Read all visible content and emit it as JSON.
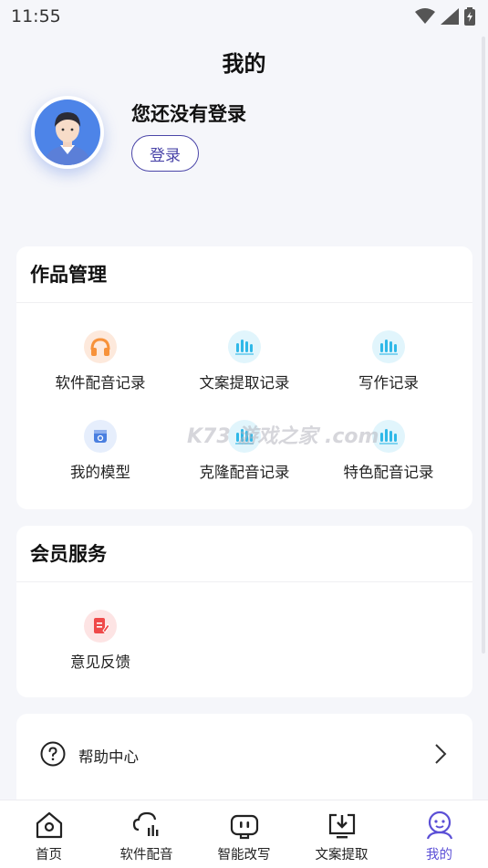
{
  "status_bar": {
    "time": "11:55",
    "icons": [
      "wifi-icon",
      "signal-icon",
      "battery-icon"
    ]
  },
  "page": {
    "title": "我的"
  },
  "profile": {
    "status_text": "您还没有登录",
    "login_label": "登录",
    "avatar_icon": "user-avatar"
  },
  "works": {
    "title": "作品管理",
    "items": [
      {
        "label": "软件配音记录",
        "icon": "headphones-icon",
        "color": "#f7923a"
      },
      {
        "label": "文案提取记录",
        "icon": "audio-bars-icon",
        "color": "#2fb8e8"
      },
      {
        "label": "写作记录",
        "icon": "audio-bars-icon",
        "color": "#2fb8e8"
      },
      {
        "label": "我的模型",
        "icon": "model-box-icon",
        "color": "#4a7fe0"
      },
      {
        "label": "克隆配音记录",
        "icon": "audio-bars-icon",
        "color": "#2fb8e8"
      },
      {
        "label": "特色配音记录",
        "icon": "audio-bars-icon",
        "color": "#2fb8e8"
      }
    ]
  },
  "member": {
    "title": "会员服务",
    "items": [
      {
        "label": "意见反馈",
        "icon": "feedback-icon",
        "color": "#ef4a4a"
      }
    ]
  },
  "list": {
    "help_label": "帮助中心"
  },
  "watermark": "K73 游戏之家 .com",
  "tabs": [
    {
      "label": "首页",
      "icon": "home-icon"
    },
    {
      "label": "软件配音",
      "icon": "dubbing-icon"
    },
    {
      "label": "智能改写",
      "icon": "robot-icon"
    },
    {
      "label": "文案提取",
      "icon": "extract-icon"
    },
    {
      "label": "我的",
      "icon": "profile-icon",
      "active": true
    }
  ],
  "colors": {
    "accent": "#5b4fd6",
    "login_border": "#4a45a8",
    "background": "#f5f6fa"
  }
}
